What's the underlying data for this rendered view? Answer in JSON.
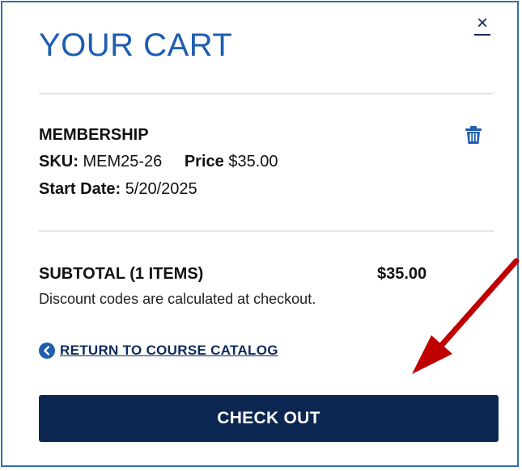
{
  "colors": {
    "title": "#1e5eb0",
    "accent_dark": "#0b2650",
    "frame_border": "#2e6eb5",
    "annotation_arrow": "#c00000"
  },
  "header": {
    "title": "YOUR CART",
    "close_glyph": "×",
    "close_icon": "close-icon"
  },
  "item": {
    "name": "MEMBERSHIP",
    "sku_label": "SKU:",
    "sku_value": "MEM25-26",
    "price_label": "Price",
    "price_value": "$35.00",
    "start_label": "Start Date:",
    "start_value": "5/20/2025",
    "remove_icon": "trash-icon"
  },
  "summary": {
    "subtotal_label": "SUBTOTAL (1 ITEMS)",
    "subtotal_amount": "$35.00",
    "discount_note": "Discount codes are calculated at checkout."
  },
  "links": {
    "return_label": "RETURN TO COURSE CATALOG",
    "return_icon": "chevron-left-circle-icon"
  },
  "checkout": {
    "button_label": "CHECK OUT"
  }
}
